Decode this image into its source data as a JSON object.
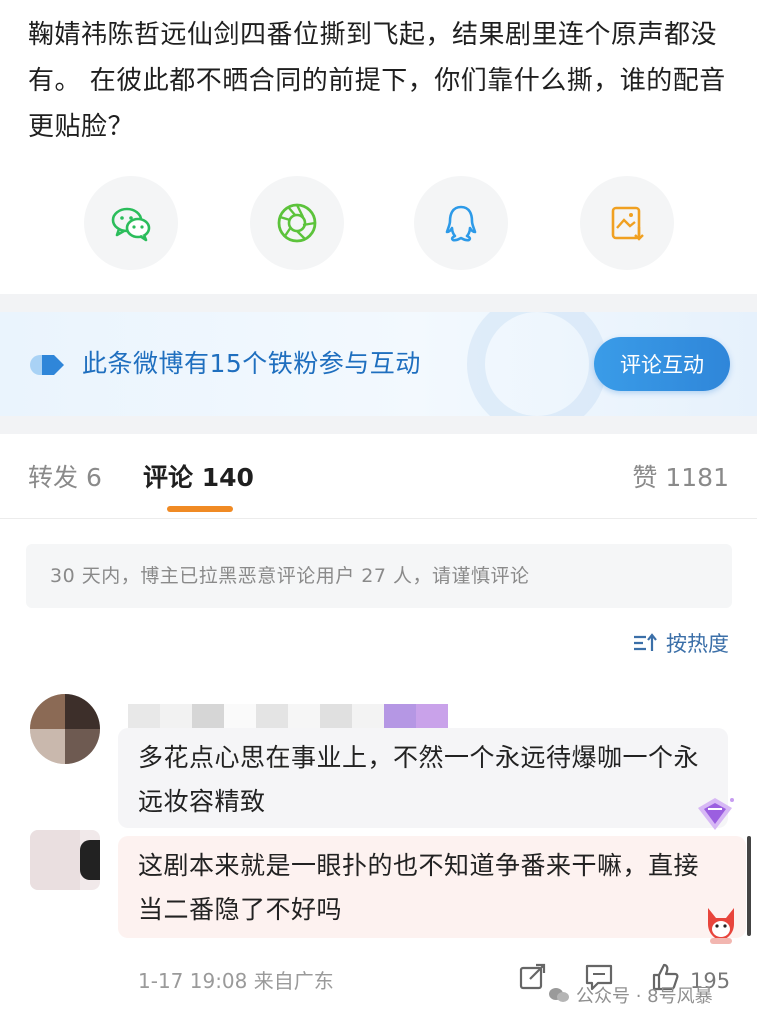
{
  "post": {
    "text": "鞠婧祎陈哲远仙剑四番位撕到飞起，结果剧里连个原声都没有。 在彼此都不晒合同的前提下，你们靠什么撕，谁的配音更贴脸？"
  },
  "share": [
    {
      "name": "wechat-share-icon",
      "color": "#2bbd5b"
    },
    {
      "name": "moments-share-icon",
      "color": "#5cc33b"
    },
    {
      "name": "qq-share-icon",
      "color": "#2d9ae8"
    },
    {
      "name": "save-image-icon",
      "color": "#f0a021"
    }
  ],
  "fans_banner": {
    "text": "此条微博有15个铁粉参与互动",
    "button_label": "评论互动"
  },
  "tabs": {
    "repost": "转发 6",
    "comment": "评论 140",
    "like": "赞 1181"
  },
  "notice": "30 天内，博主已拉黑恶意评论用户 27 人，请谨慎评论",
  "sort": {
    "label": "按热度"
  },
  "comment": {
    "text": "多花点心思在事业上，不然一个永远待爆咖一个永远妆容精致",
    "reply_text": "这剧本来就是一眼扑的也不知道争番来干嘛，直接当二番隐了不好吗",
    "time_location": "1-17 19:08 来自广东",
    "like_count": "195"
  },
  "watermark": {
    "text": "公众号 · 8号风暴"
  },
  "colors": {
    "accent_orange": "#f08a24",
    "link_blue": "#3b6fa8",
    "banner_blue": "#1f6fbf"
  }
}
